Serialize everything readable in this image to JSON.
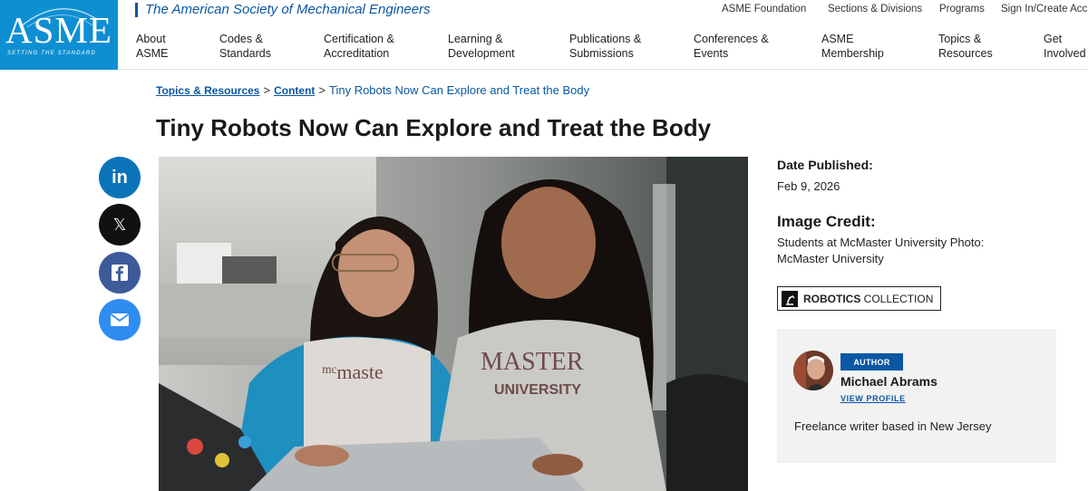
{
  "header": {
    "logo_text": "ASME",
    "logo_tagline": "SETTING THE STANDARD",
    "org_name": "The American Society of Mechanical Engineers",
    "utility_links": [
      "ASME Foundation",
      "Sections & Divisions",
      "Programs",
      "Sign In/Create Acc"
    ],
    "nav": [
      {
        "line1": "About",
        "line2": "ASME"
      },
      {
        "line1": "Codes &",
        "line2": "Standards"
      },
      {
        "line1": "Certification &",
        "line2": "Accreditation"
      },
      {
        "line1": "Learning &",
        "line2": "Development"
      },
      {
        "line1": "Publications &",
        "line2": "Submissions"
      },
      {
        "line1": "Conferences &",
        "line2": "Events"
      },
      {
        "line1": "ASME",
        "line2": "Membership"
      },
      {
        "line1": "Topics &",
        "line2": "Resources"
      },
      {
        "line1": "Get",
        "line2": "Involved"
      }
    ]
  },
  "breadcrumb": {
    "items": [
      "Topics & Resources",
      "Content"
    ],
    "separator": ">",
    "current": "Tiny Robots Now Can Explore and Treat the Body"
  },
  "article": {
    "title": "Tiny Robots Now Can Explore and Treat the Body",
    "image_shirt_text_1": "MASTER",
    "image_shirt_text_2": "UNIVERSITY"
  },
  "share": {
    "linkedin_text": "in",
    "x_text": "𝕏",
    "icons": [
      "linkedin-icon",
      "x-icon",
      "facebook-icon",
      "email-icon"
    ]
  },
  "sidebar": {
    "date_label": "Date Published:",
    "date_value": "Feb 9, 2026",
    "credit_label": "Image Credit:",
    "credit_value": "Students at McMaster University Photo: McMaster University",
    "collection_bold": "ROBOTICS",
    "collection_rest": " COLLECTION"
  },
  "author": {
    "badge": "AUTHOR",
    "name": "Michael Abrams",
    "view_profile": "VIEW PROFILE",
    "bio": "Freelance writer based in New Jersey"
  },
  "colors": {
    "brand_blue": "#0f8fd3",
    "link_blue": "#0a57a3",
    "linkedin": "#0b74b8",
    "facebook": "#3d5a99",
    "email": "#2f8cf0"
  }
}
